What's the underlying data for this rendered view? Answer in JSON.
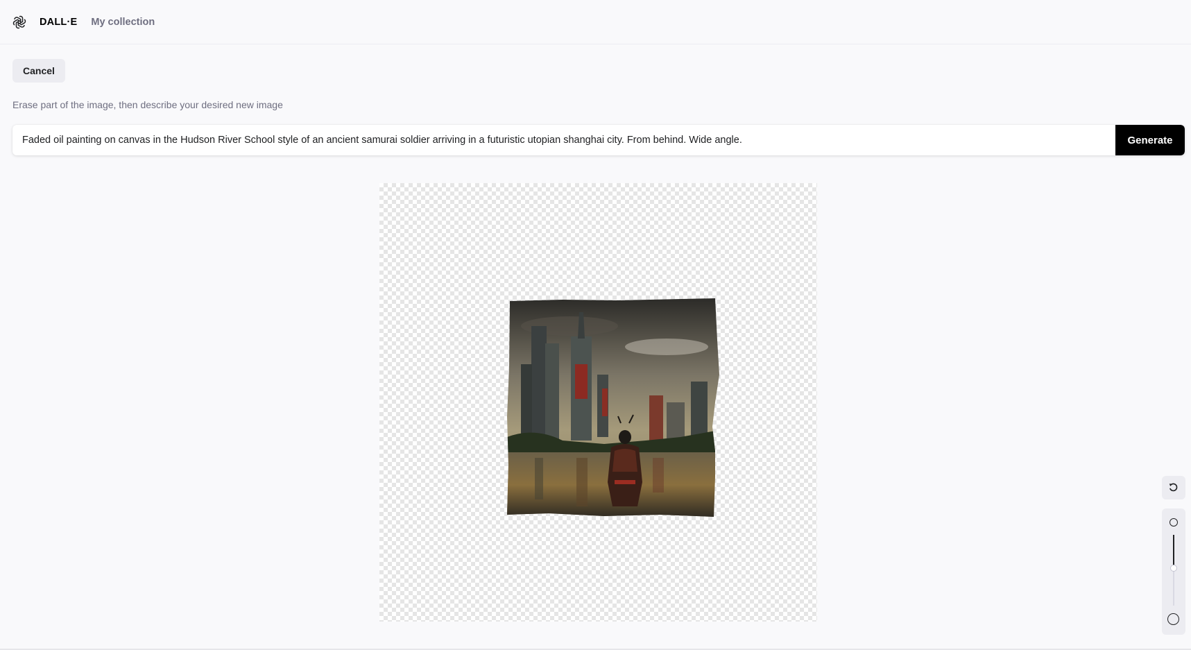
{
  "header": {
    "brand": "DALL·E",
    "collection_link": "My collection",
    "logo_icon": "openai-logo-icon"
  },
  "editor": {
    "cancel_label": "Cancel",
    "instructions": "Erase part of the image, then describe your desired new image",
    "prompt_value": "Faded oil painting on canvas in the Hudson River School style of an ancient samurai soldier arriving in a futuristic utopian shanghai city. From behind. Wide angle.",
    "generate_label": "Generate"
  },
  "tools": {
    "undo_icon": "undo-icon",
    "brush_size_fraction": 0.47
  },
  "colors": {
    "background": "#f9f9fb",
    "primary_button": "#000000",
    "secondary_button": "#ececf1",
    "muted_text": "#6e6e80"
  }
}
